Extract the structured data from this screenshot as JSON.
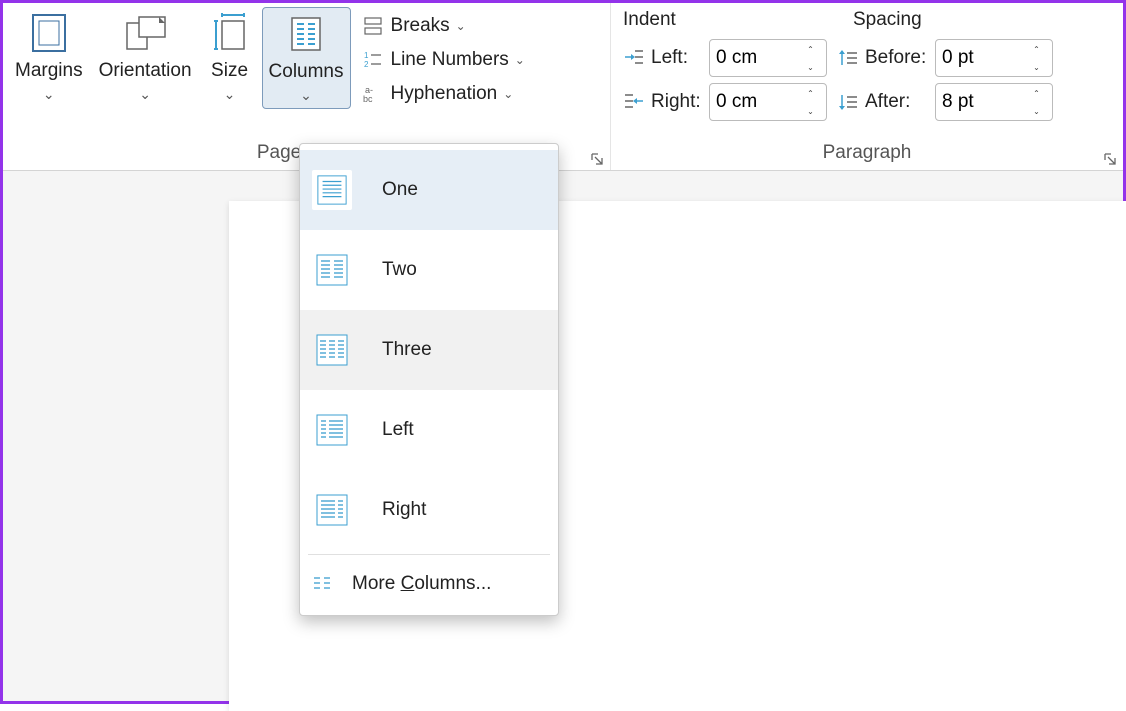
{
  "ribbon": {
    "page_setup": {
      "label": "Page Setup",
      "margins": "Margins",
      "orientation": "Orientation",
      "size": "Size",
      "columns": "Columns",
      "breaks": "Breaks",
      "line_numbers": "Line Numbers",
      "hyphenation": "Hyphenation"
    },
    "paragraph": {
      "label": "Paragraph",
      "indent_header": "Indent",
      "spacing_header": "Spacing",
      "left_label": "Left:",
      "right_label": "Right:",
      "before_label": "Before:",
      "after_label": "After:",
      "left_value": "0 cm",
      "right_value": "0 cm",
      "before_value": "0 pt",
      "after_value": "8 pt"
    }
  },
  "columns_menu": {
    "items": [
      {
        "label": "One"
      },
      {
        "label": "Two"
      },
      {
        "label": "Three"
      },
      {
        "label": "Left"
      },
      {
        "label": "Right"
      }
    ],
    "more_prefix": "More ",
    "more_underline": "C",
    "more_suffix": "olumns..."
  }
}
